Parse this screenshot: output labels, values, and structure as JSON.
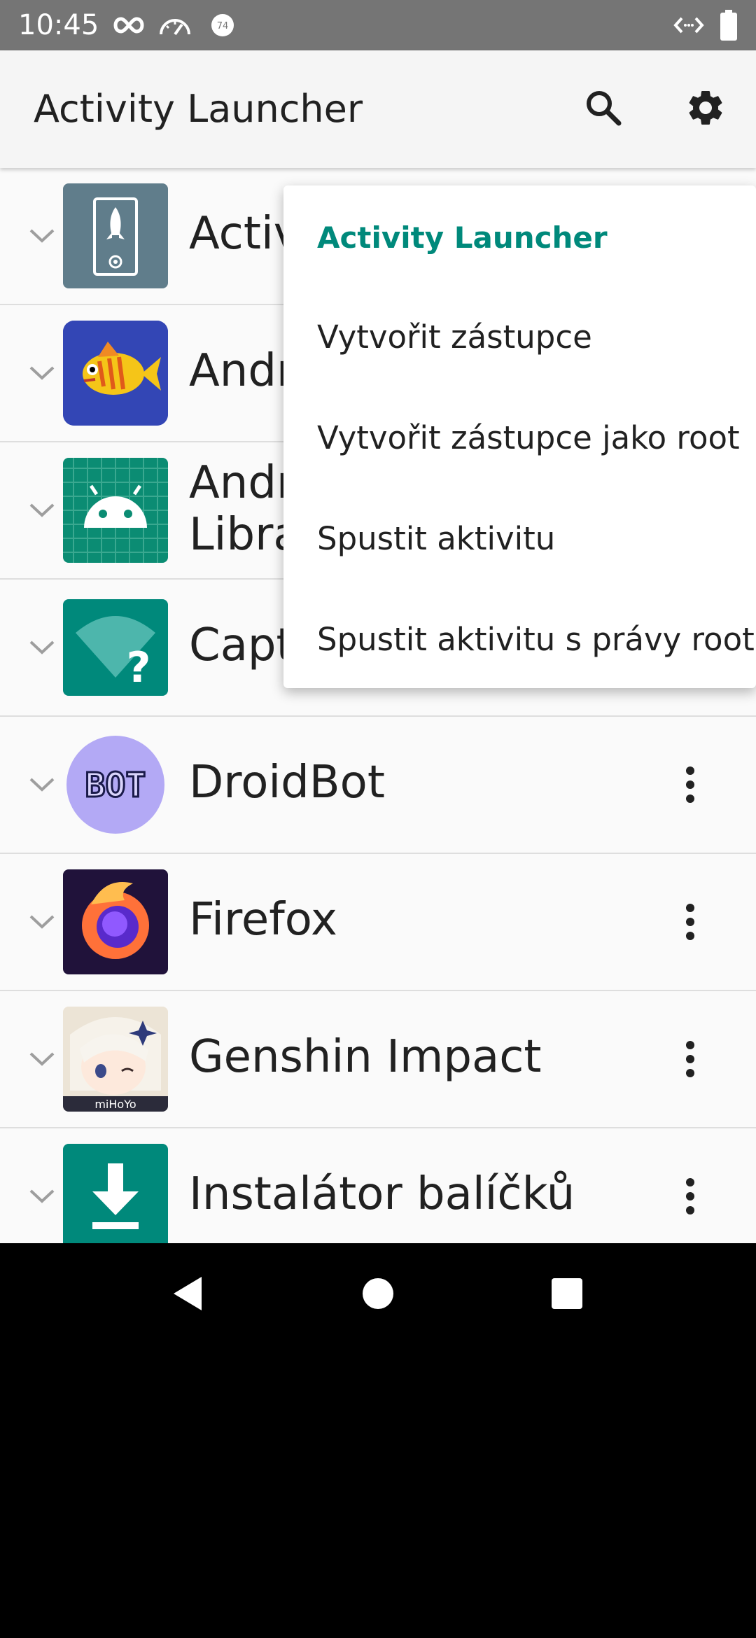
{
  "status_bar": {
    "time": "10:45",
    "icons": [
      "infinity-icon",
      "speedometer-icon",
      "badge-74-icon",
      "code-icon",
      "battery-icon"
    ],
    "badge_number": "74"
  },
  "app_bar": {
    "title": "Activity Launcher",
    "icons": [
      "search-icon",
      "gear-icon"
    ]
  },
  "apps": [
    {
      "name": "Activity Launcher",
      "visible_text": "Activ"
    },
    {
      "name": "Android",
      "visible_text": "Andr"
    },
    {
      "name": "Android Library",
      "visible_text_line1": "Andr",
      "visible_text_line2": "Libra"
    },
    {
      "name": "Captive",
      "visible_text": "Capt"
    },
    {
      "name": "DroidBot",
      "visible_text": "DroidBot"
    },
    {
      "name": "Firefox",
      "visible_text": "Firefox"
    },
    {
      "name": "Genshin Impact",
      "visible_text": "Genshin Impact"
    },
    {
      "name": "Instalátor balíčků",
      "visible_text": "Instalátor balíčků"
    }
  ],
  "context_menu": {
    "header": "Activity Launcher",
    "items": [
      "Vytvořit zástupce",
      "Vytvořit zástupce jako root",
      "Spustit aktivitu",
      "Spustit aktivitu s právy root"
    ]
  },
  "icon_labels": {
    "droidbot": "BOT",
    "genshin": "miHoYo"
  },
  "colors": {
    "accent": "#00897b",
    "status_bar": "#757575",
    "app_bar": "#f5f5f5"
  },
  "nav_bar": [
    "back-icon",
    "home-icon",
    "recents-icon"
  ]
}
